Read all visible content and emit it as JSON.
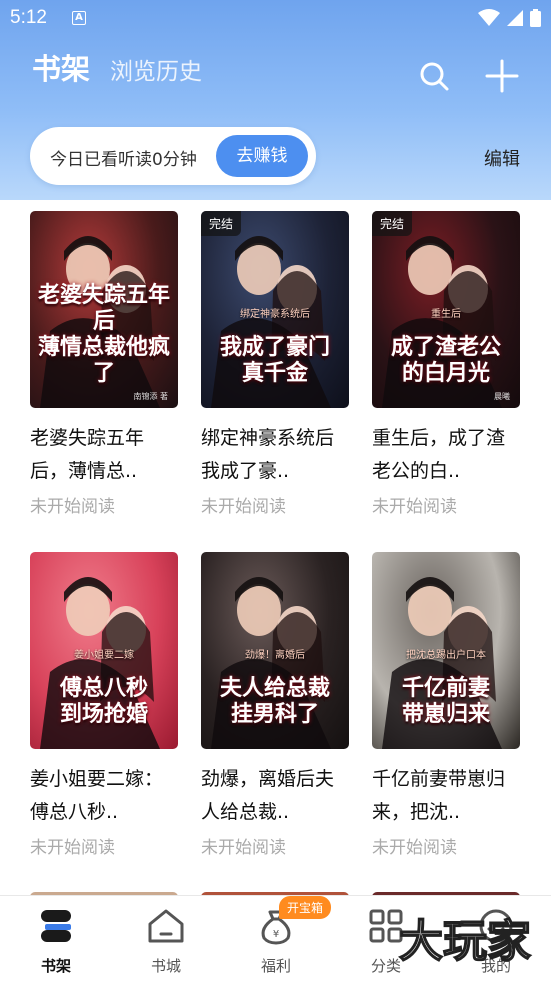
{
  "status_bar": {
    "time": "5:12",
    "a_icon": "A"
  },
  "header": {
    "tab_bookshelf": "书架",
    "tab_history": "浏览历史",
    "reading_today": "今日已看听读0分钟",
    "earn_button": "去赚钱",
    "edit": "编辑"
  },
  "books": [
    {
      "title": "老婆失踪五年后，薄情总..",
      "status": "未开始阅读",
      "cover_title": "老婆失踪五年后\n薄情总裁他疯了",
      "cover_sub": "",
      "cover_author": "南锦添 著",
      "badge": "",
      "colors": [
        "#4a1b1b",
        "#b23a3a",
        "#1a0f12"
      ]
    },
    {
      "title": "绑定神豪系统后我成了豪..",
      "status": "未开始阅读",
      "cover_title": "我成了豪门\n真千金",
      "cover_sub": "绑定神豪系统后",
      "cover_author": "",
      "badge": "完结",
      "colors": [
        "#1d2236",
        "#3c4a6e",
        "#0d0f1a"
      ]
    },
    {
      "title": "重生后，成了渣老公的白..",
      "status": "未开始阅读",
      "cover_title": "成了渣老公\n的白月光",
      "cover_sub": "重生后",
      "cover_author": "晨曦",
      "badge": "完结",
      "colors": [
        "#2a1216",
        "#7a1d24",
        "#140a0c"
      ]
    },
    {
      "title": "姜小姐要二嫁：傅总八秒..",
      "status": "未开始阅读",
      "cover_title": "傅总八秒\n到场抢婚",
      "cover_sub": "姜小姐要二嫁",
      "cover_author": "",
      "badge": "",
      "colors": [
        "#d8425a",
        "#f07b8a",
        "#9a1a30"
      ]
    },
    {
      "title": "劲爆，离婚后夫人给总裁..",
      "status": "未开始阅读",
      "cover_title": "夫人给总裁\n挂男科了",
      "cover_sub": "劲爆！离婚后",
      "cover_author": "",
      "badge": "",
      "colors": [
        "#2a2222",
        "#6a5a58",
        "#141010"
      ]
    },
    {
      "title": "千亿前妻带崽归来，把沈..",
      "status": "未开始阅读",
      "cover_title": "千亿前妻\n带崽归来",
      "cover_sub": "把沈总踢出户口本",
      "cover_author": "",
      "badge": "",
      "colors": [
        "#b8b4ae",
        "#6b6560",
        "#2a2622"
      ]
    }
  ],
  "bottom_nav": [
    {
      "label": "书架",
      "icon": "bookshelf-icon",
      "active": true
    },
    {
      "label": "书城",
      "icon": "store-icon",
      "active": false
    },
    {
      "label": "福利",
      "icon": "gift-bag-icon",
      "active": false
    },
    {
      "label": "分类",
      "icon": "category-icon",
      "active": false
    },
    {
      "label": "我的",
      "icon": "profile-icon",
      "active": false
    }
  ],
  "treasure_badge": "开宝箱",
  "watermark_text": "大玩家",
  "colors": {
    "accent": "#4d8ff0",
    "badge_orange": "#ff8b1f"
  }
}
